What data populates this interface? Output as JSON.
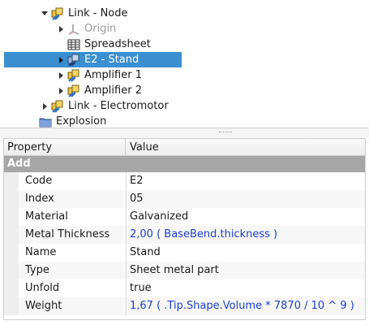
{
  "tree": {
    "items": [
      {
        "label": "Link - Node",
        "icon": "link-icon"
      },
      {
        "label": "Origin",
        "icon": "origin-icon"
      },
      {
        "label": "Spreadsheet",
        "icon": "spreadsheet-icon"
      },
      {
        "label": "E2 - Stand",
        "icon": "link-icon"
      },
      {
        "label": "Amplifier 1",
        "icon": "link-icon"
      },
      {
        "label": "Amplifier 2",
        "icon": "link-icon"
      },
      {
        "label": "Link - Electromotor",
        "icon": "link-icon"
      },
      {
        "label": "Explosion",
        "icon": "folder-icon"
      }
    ],
    "selected_color": "#3b8fd0"
  },
  "properties": {
    "header": {
      "property": "Property",
      "value": "Value"
    },
    "group": "Add",
    "rows": [
      {
        "name": "Code",
        "value": "E2"
      },
      {
        "name": "Index",
        "value": "05"
      },
      {
        "name": "Material",
        "value": "Galvanized"
      },
      {
        "name": "Metal Thickness",
        "value": "2,00  ( BaseBend.thickness )"
      },
      {
        "name": "Name",
        "value": "Stand"
      },
      {
        "name": "Type",
        "value": "Sheet metal part"
      },
      {
        "name": "Unfold",
        "value": "true"
      },
      {
        "name": "Weight",
        "value": "1,67  ( .Tip.Shape.Volume * 7870 / 10 ^ 9 )"
      }
    ],
    "expression_color": "#1d3fd1"
  }
}
